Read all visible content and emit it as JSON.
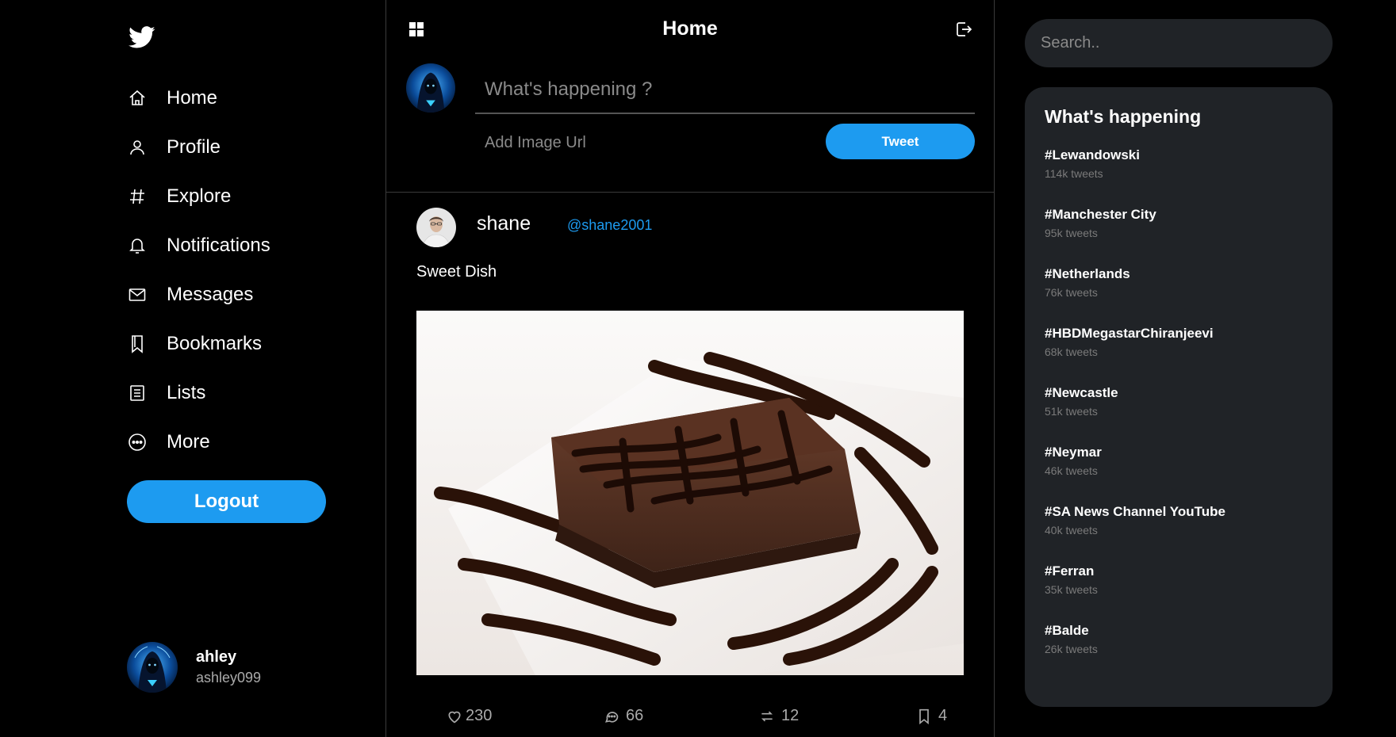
{
  "nav": {
    "items": [
      {
        "label": "Home",
        "icon": "home-icon"
      },
      {
        "label": "Profile",
        "icon": "user-icon"
      },
      {
        "label": "Explore",
        "icon": "hashtag-icon"
      },
      {
        "label": "Notifications",
        "icon": "bell-icon"
      },
      {
        "label": "Messages",
        "icon": "mail-icon"
      },
      {
        "label": "Bookmarks",
        "icon": "bookmark-icon"
      },
      {
        "label": "Lists",
        "icon": "list-icon"
      },
      {
        "label": "More",
        "icon": "more-icon"
      }
    ],
    "logout_label": "Logout"
  },
  "current_user": {
    "name": "ahley",
    "handle": "ashley099"
  },
  "header": {
    "title": "Home"
  },
  "compose": {
    "placeholder": "What's happening ?",
    "image_placeholder": "Add Image Url",
    "tweet_label": "Tweet"
  },
  "post": {
    "name": "shane",
    "handle": "@shane2001",
    "text": "Sweet Dish",
    "likes": "230",
    "comments": "66",
    "retweets": "12",
    "bookmarks": "4"
  },
  "search": {
    "placeholder": "Search.."
  },
  "trends": {
    "title": "What's happening",
    "items": [
      {
        "tag": "#Lewandowski",
        "count": "114k tweets"
      },
      {
        "tag": "#Manchester City",
        "count": "95k tweets"
      },
      {
        "tag": "#Netherlands",
        "count": "76k tweets"
      },
      {
        "tag": "#HBDMegastarChiranjeevi",
        "count": "68k tweets"
      },
      {
        "tag": "#Newcastle",
        "count": "51k tweets"
      },
      {
        "tag": "#Neymar",
        "count": "46k tweets"
      },
      {
        "tag": "#SA News Channel YouTube",
        "count": "40k tweets"
      },
      {
        "tag": "#Ferran",
        "count": "35k tweets"
      },
      {
        "tag": "#Balde",
        "count": "26k tweets"
      }
    ]
  },
  "colors": {
    "accent": "#1d9bf0",
    "panel": "#202327",
    "background": "#000000"
  }
}
